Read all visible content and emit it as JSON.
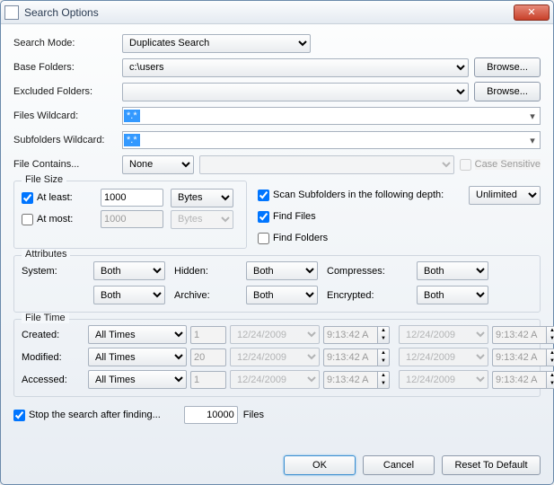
{
  "window": {
    "title": "Search Options"
  },
  "labels": {
    "searchMode": "Search Mode:",
    "baseFolders": "Base Folders:",
    "excludedFolders": "Excluded Folders:",
    "filesWildcard": "Files Wildcard:",
    "subfoldersWildcard": "Subfolders Wildcard:",
    "fileContains": "File Contains...",
    "caseSensitive": "Case Sensitive",
    "browse": "Browse...",
    "fileSize": "File Size",
    "atLeast": "At least:",
    "atMost": "At most:",
    "scanSubfolders": "Scan Subfolders in the following depth:",
    "findFiles": "Find Files",
    "findFolders": "Find Folders",
    "attributes": "Attributes",
    "system": "System:",
    "hidden": "Hidden:",
    "compresses": "Compresses:",
    "archive": "Archive:",
    "encrypted": "Encrypted:",
    "fileTime": "File Time",
    "created": "Created:",
    "modified": "Modified:",
    "accessed": "Accessed:",
    "stopAfter": "Stop the search after finding...",
    "files": "Files",
    "ok": "OK",
    "cancel": "Cancel",
    "reset": "Reset To Default"
  },
  "values": {
    "searchMode": "Duplicates Search",
    "baseFolders": "c:\\users",
    "excludedFolders": "",
    "filesWildcard": "*.*",
    "subfoldersWildcard": "*.*",
    "fileContains": "None",
    "fileContainsText": "",
    "caseSensitive": false,
    "atLeastChecked": true,
    "atLeastValue": "1000",
    "atLeastUnit": "Bytes",
    "atMostChecked": false,
    "atMostValue": "1000",
    "atMostUnit": "Bytes",
    "scanSubfoldersChecked": true,
    "depth": "Unlimited",
    "findFilesChecked": true,
    "findFoldersChecked": false,
    "attrSystem": "Both",
    "attrHidden": "Both",
    "attrCompresses": "Both",
    "attrExtra": "Both",
    "attrArchive": "Both",
    "attrEncrypted": "Both",
    "ftCreatedMode": "All Times",
    "ftCreatedN": "1",
    "ftCreatedDate1": "12/24/2009",
    "ftCreatedTime1": "9:13:42 A",
    "ftCreatedDate2": "12/24/2009",
    "ftCreatedTime2": "9:13:42 A",
    "ftModifiedMode": "All Times",
    "ftModifiedN": "20",
    "ftModifiedDate1": "12/24/2009",
    "ftModifiedTime1": "9:13:42 A",
    "ftModifiedDate2": "12/24/2009",
    "ftModifiedTime2": "9:13:42 A",
    "ftAccessedMode": "All Times",
    "ftAccessedN": "1",
    "ftAccessedDate1": "12/24/2009",
    "ftAccessedTime1": "9:13:42 A",
    "ftAccessedDate2": "12/24/2009",
    "ftAccessedTime2": "9:13:42 A",
    "stopAfterChecked": true,
    "stopAfterCount": "10000"
  }
}
